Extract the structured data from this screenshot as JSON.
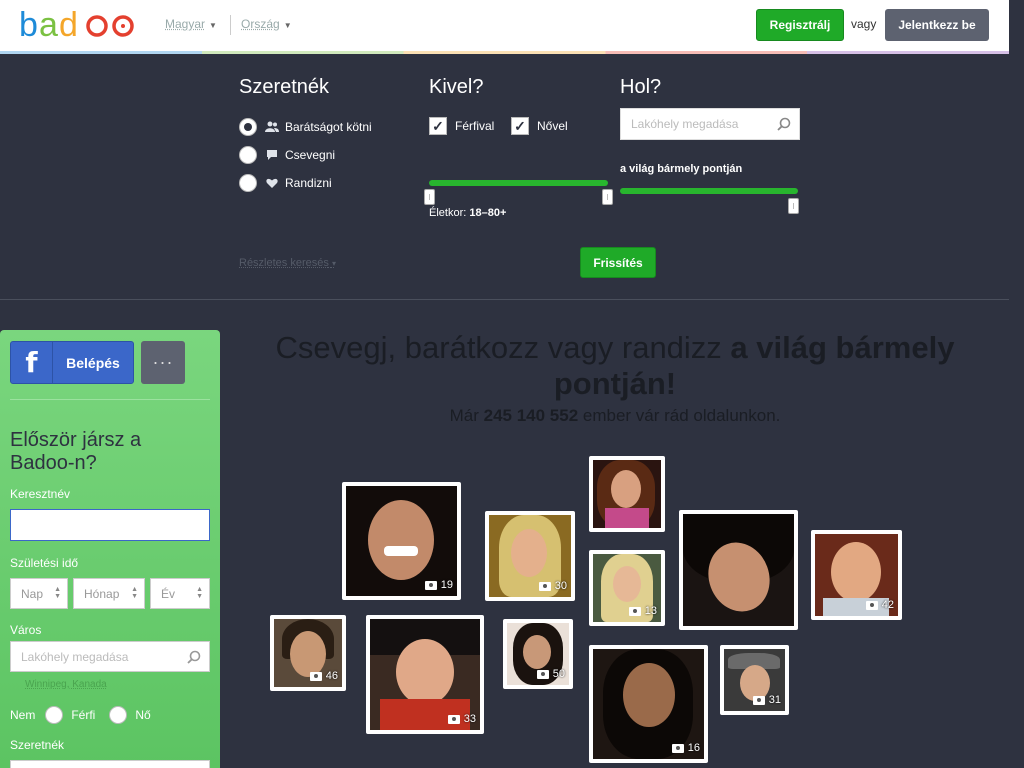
{
  "header": {
    "logo_text": "badoo",
    "language": "Magyar",
    "country": "Ország",
    "register": "Regisztrálj",
    "or": "vagy",
    "login": "Jelentkezz be"
  },
  "search": {
    "want_title": "Szeretnék",
    "want_options": [
      "Barátságot kötni",
      "Csevegni",
      "Randizni"
    ],
    "who_title": "Kivel?",
    "who_options": [
      "Férfival",
      "Nővel"
    ],
    "age_prefix": "Életkor:",
    "age_value": "18–80+",
    "where_title": "Hol?",
    "location_placeholder": "Lakóhely megadása",
    "world_label": "a világ bármely pontján",
    "advanced": "Részletes keresés",
    "refresh": "Frissítés"
  },
  "signup": {
    "fb_icon": "f",
    "fb_login": "Belépés",
    "more": "···",
    "title": "Először jársz a Badoo-n?",
    "first_name_label": "Keresztnév",
    "birth_label": "Születési idő",
    "day": "Nap",
    "month": "Hónap",
    "year": "Év",
    "city_label": "Város",
    "city_placeholder": "Lakóhely megadása",
    "city_hint": "Winnipeg, Kanada",
    "sex_label": "Nem",
    "male": "Férfi",
    "female": "Nő",
    "want_label": "Szeretnék"
  },
  "hero": {
    "title_regular": "Csevegj, barátkozz vagy randizz ",
    "title_bold": "a világ bármely pontján!",
    "sub_prefix": "Már ",
    "sub_count": "245 140 552",
    "sub_suffix": " ember vár rád oldalunkon."
  },
  "photos": [
    {
      "count": "19"
    },
    {
      "count": "30"
    },
    {
      "count": ""
    },
    {
      "count": "13"
    },
    {
      "count": ""
    },
    {
      "count": "42"
    },
    {
      "count": "46"
    },
    {
      "count": "33"
    },
    {
      "count": "50"
    },
    {
      "count": "16"
    },
    {
      "count": "31"
    }
  ],
  "colors": {
    "accent_green": "#1faa28",
    "dark_bg": "#2e3240",
    "facebook": "#3b67c9",
    "signup_green": "#6ccf71"
  }
}
